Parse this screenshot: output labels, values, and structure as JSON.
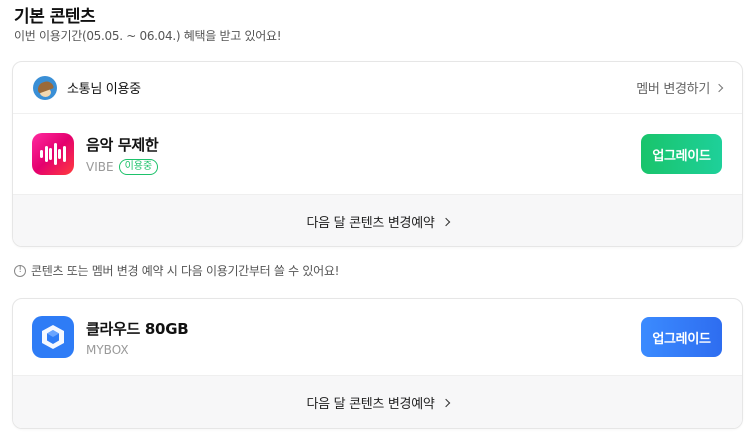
{
  "header": {
    "title": "기본 콘텐츠",
    "subtitle": "이번 이용기간(05.05. ~ 06.04.) 혜택을 받고 있어요!"
  },
  "member": {
    "name": "소통님 이용중",
    "change_label": "멤버 변경하기"
  },
  "products": [
    {
      "title": "음악 무제한",
      "service": "VIBE",
      "badge": "이용중",
      "button_label": "업그레이드",
      "next_label": "다음 달 콘텐츠 변경예약",
      "icon": "vibe-icon",
      "button_color": "#19c46b"
    },
    {
      "title": "클라우드 80GB",
      "service": "MYBOX",
      "button_label": "업그레이드",
      "next_label": "다음 달 콘텐츠 변경예약",
      "icon": "mybox-icon",
      "button_color": "#3b8bff"
    }
  ],
  "notice": {
    "icon": "info-icon",
    "text": "콘텐츠 또는 멤버 변경 예약 시 다음 이용기간부터 쓸 수 있어요!"
  }
}
